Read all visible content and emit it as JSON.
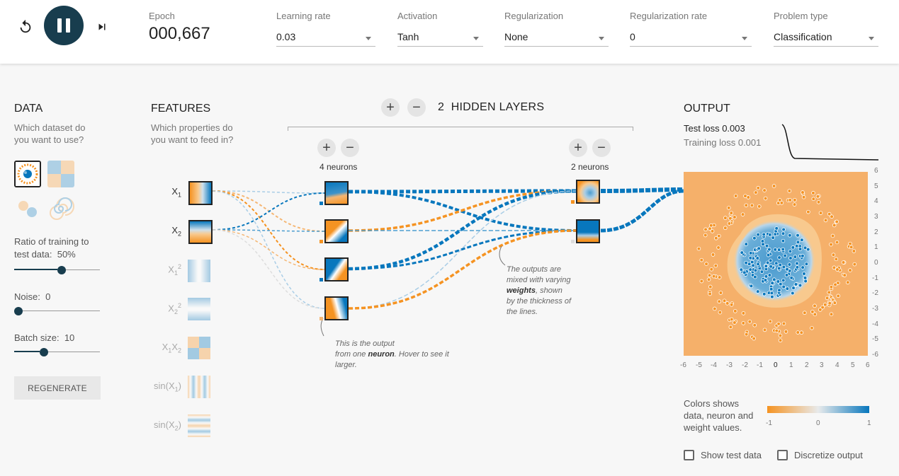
{
  "controls": {
    "epoch_label": "Epoch",
    "epoch_value": "000,667",
    "learning_rate": {
      "label": "Learning rate",
      "value": "0.03"
    },
    "activation": {
      "label": "Activation",
      "value": "Tanh"
    },
    "regularization": {
      "label": "Regularization",
      "value": "None"
    },
    "regularization_rate": {
      "label": "Regularization rate",
      "value": "0"
    },
    "problem_type": {
      "label": "Problem type",
      "value": "Classification"
    }
  },
  "data": {
    "title": "DATA",
    "subtitle_line1": "Which dataset do",
    "subtitle_line2": "you want to use?",
    "ratio_label_line1": "Ratio of training to",
    "ratio_label_line2": "test data:",
    "ratio_value": "50%",
    "ratio_fraction": 0.5,
    "noise_label": "Noise:",
    "noise_value": "0",
    "noise_fraction": 0,
    "batch_label": "Batch size:",
    "batch_value": "10",
    "batch_fraction": 0.3,
    "regenerate_label": "REGENERATE"
  },
  "features": {
    "title": "FEATURES",
    "subtitle_line1": "Which properties do",
    "subtitle_line2": "you want to feed in?",
    "items": [
      {
        "base": "X",
        "sub": "1",
        "sup": "",
        "active": true
      },
      {
        "base": "X",
        "sub": "2",
        "sup": "",
        "active": true
      },
      {
        "base": "X",
        "sub": "1",
        "sup": "2",
        "active": false
      },
      {
        "base": "X",
        "sub": "2",
        "sup": "2",
        "active": false
      },
      {
        "base": "X",
        "sub": "1",
        "sup": "",
        "base2": "X",
        "sub2": "2",
        "active": false
      },
      {
        "base": "sin(X",
        "sub": "1",
        "sup": "",
        "suffix": ")",
        "active": false
      },
      {
        "base": "sin(X",
        "sub": "2",
        "sup": "",
        "suffix": ")",
        "active": false
      }
    ]
  },
  "network": {
    "hidden_layers_count": "2",
    "hidden_layers_label": "HIDDEN LAYERS",
    "layer1_neurons": "4 neurons",
    "layer2_neurons": "2 neurons",
    "plus_symbol": "+",
    "minus_symbol": "−"
  },
  "annotations": {
    "neuron_text1": "This is the output",
    "neuron_text2": "from one",
    "neuron_bold": "neuron",
    "neuron_text3": ". Hover to see it",
    "neuron_text4": "larger.",
    "weights_text1": "The outputs are",
    "weights_text2": "mixed with varying",
    "weights_bold": "weights",
    "weights_text3": ", shown",
    "weights_text4": "by the thickness of",
    "weights_text5": "the lines."
  },
  "output": {
    "title": "OUTPUT",
    "test_loss_label": "Test loss",
    "test_loss_value": "0.003",
    "training_loss_label": "Training loss",
    "training_loss_value": "0.001",
    "x_ticks": [
      "-6",
      "-5",
      "-4",
      "-3",
      "-2",
      "-1",
      "0",
      "1",
      "2",
      "3",
      "4",
      "5",
      "6"
    ],
    "y_ticks": [
      "6",
      "5",
      "4",
      "3",
      "2",
      "1",
      "0",
      "-1",
      "-2",
      "-3",
      "-4",
      "-5",
      "-6"
    ],
    "legend_line1": "Colors shows",
    "legend_line2": "data, neuron and",
    "legend_line3": "weight values.",
    "legend_min": "-1",
    "legend_mid": "0",
    "legend_max": "1",
    "show_test_label": "Show test data",
    "discretize_label": "Discretize output"
  },
  "colors": {
    "orange": "#f59322",
    "blue": "#0877bd",
    "dark": "#183d4e"
  }
}
